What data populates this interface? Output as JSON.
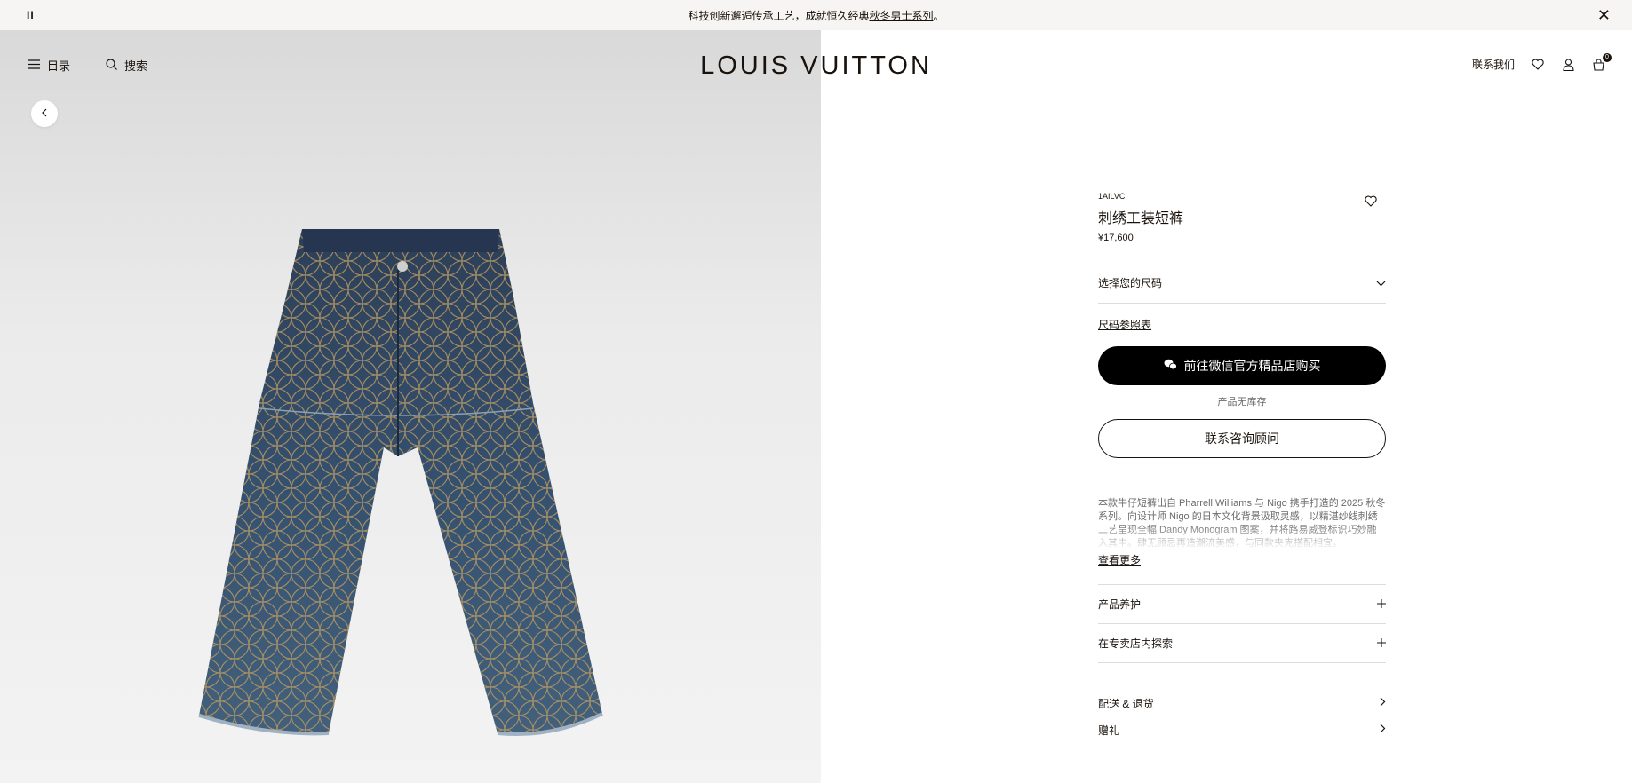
{
  "announcement": {
    "text": "科技创新邂逅传承工艺，成就恒久经典",
    "link": "秋冬男士系列",
    "suffix": "。",
    "pause_glyph": "II",
    "close_glyph": "✕"
  },
  "header": {
    "menu_label": "目录",
    "search_label": "搜索",
    "logo": "LOUIS VUITTON",
    "contact_label": "联系我们",
    "cart_count": "0"
  },
  "product": {
    "sku": "1AILVC",
    "title": "刺绣工装短裤",
    "price": "¥17,600",
    "size_select": "选择您的尺码",
    "size_guide": "尺码参照表",
    "wechat_button": "前往微信官方精品店购买",
    "stock_status": "产品无库存",
    "contact_button": "联系咨询顾问",
    "description": "本款牛仔短裤出自 Pharrell Williams 与 Nigo 携手打造的 2025 秋冬系列。向设计师 Nigo 的日本文化背景汲取灵感，以精湛纱线刺绣工艺呈现全幅 Dandy Monogram 图案，并将路易威登标识巧妙融入其中。肆无顾忌再造潮流美感，与同款夹克搭配相宜。",
    "read_more": "查看更多",
    "accordion": [
      "产品养护",
      "在专卖店内探索"
    ],
    "links": [
      "配送 & 退货",
      "赠礼"
    ]
  }
}
